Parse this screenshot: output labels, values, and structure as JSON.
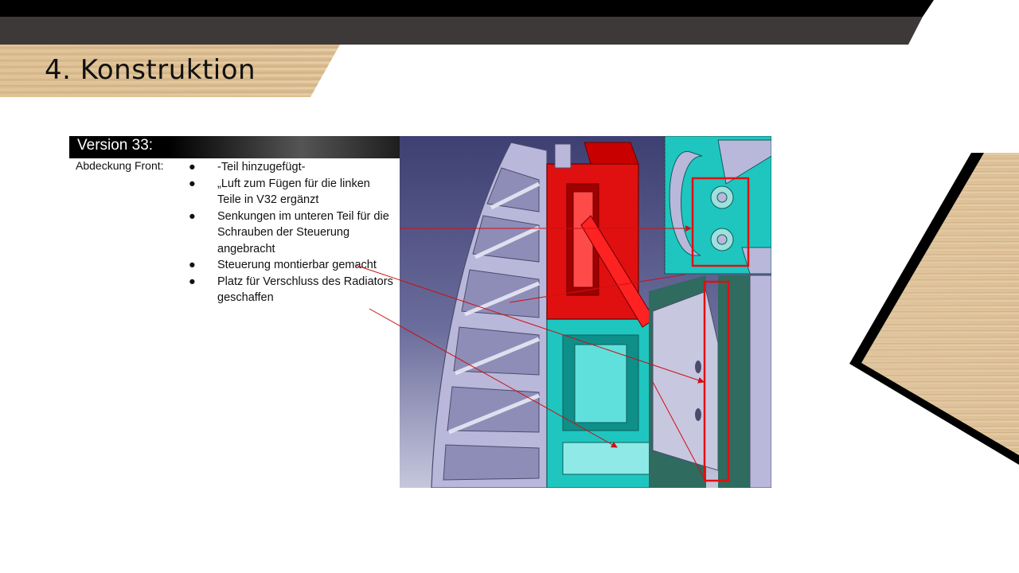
{
  "slide": {
    "title": "4. Konstruktion",
    "version_label": "Version 33:",
    "section_label": "Abdeckung Front:",
    "bullets": [
      "-Teil hinzugefügt-",
      "„Luft zum Fügen für die linken Teile in V32 ergänzt",
      "Senkungen im unteren Teil für die Schrauben der Steuerung angebracht",
      "Steuerung montierbar gemacht",
      "Platz für Verschluss des Radiators geschaffen"
    ],
    "bullet_glyph": "●"
  },
  "colors": {
    "header_black": "#000000",
    "header_dark": "#3d3939",
    "wood": "#d9bb8e",
    "cad_red": "#e01010",
    "cad_cyan": "#1fc6c0",
    "cad_lilac": "#b9b8da",
    "annotation_line": "#cc1111"
  }
}
